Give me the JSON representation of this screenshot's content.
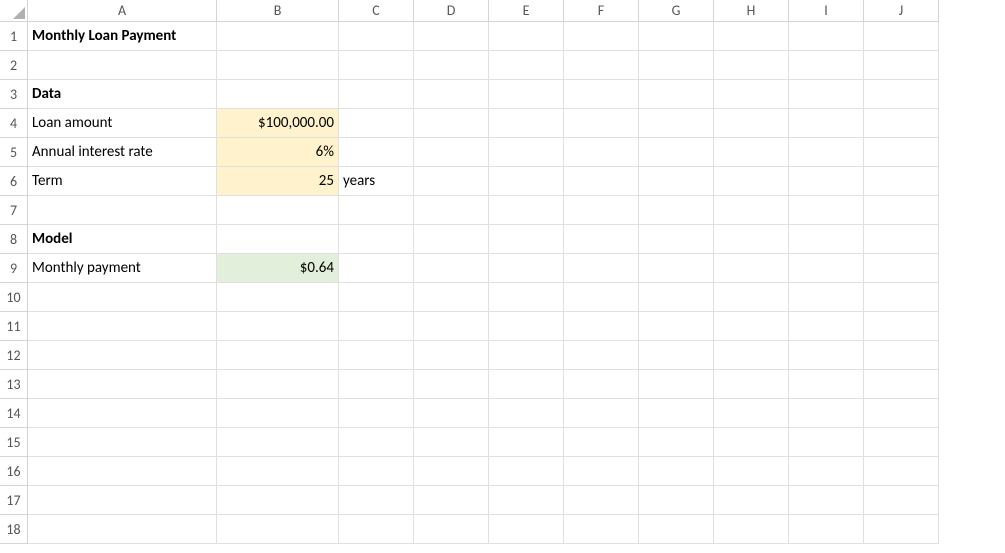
{
  "columns": [
    "A",
    "B",
    "C",
    "D",
    "E",
    "F",
    "G",
    "H",
    "I",
    "J"
  ],
  "rows": [
    "1",
    "2",
    "3",
    "4",
    "5",
    "6",
    "7",
    "8",
    "9",
    "10",
    "11",
    "12",
    "13",
    "14",
    "15",
    "16",
    "17",
    "18"
  ],
  "cells": {
    "A1": "Monthly Loan Payment",
    "A3": "Data",
    "A4": "Loan amount",
    "B4": "$100,000.00",
    "A5": "Annual interest rate",
    "B5": "6%",
    "A6": "Term",
    "B6": "25",
    "C6": "years",
    "A8": "Model",
    "A9": "Monthly payment",
    "B9": "$0.64"
  }
}
